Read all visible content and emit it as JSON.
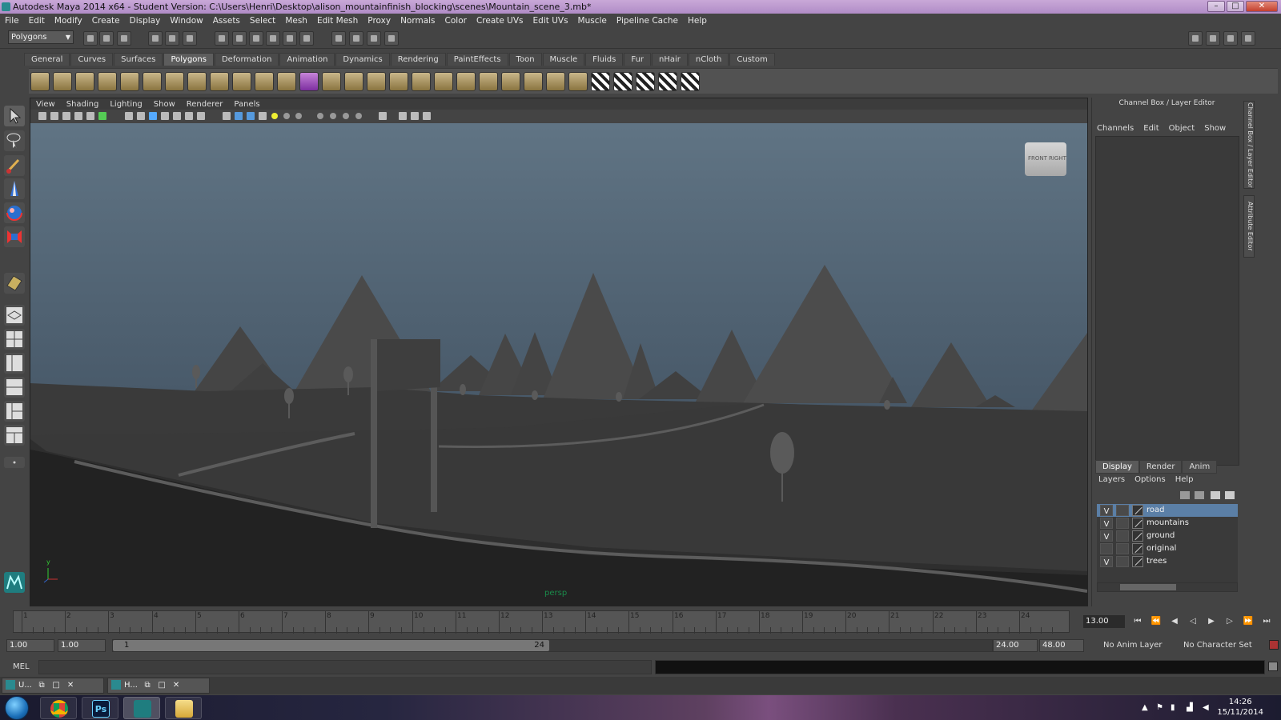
{
  "window": {
    "title": "Autodesk Maya 2014 x64 - Student Version: C:\\Users\\Henri\\Desktop\\alison_mountainfinish_blocking\\scenes\\Mountain_scene_3.mb*",
    "min": "–",
    "max": "□",
    "close": "✕"
  },
  "menubar": [
    "File",
    "Edit",
    "Modify",
    "Create",
    "Display",
    "Window",
    "Assets",
    "Select",
    "Mesh",
    "Edit Mesh",
    "Proxy",
    "Normals",
    "Color",
    "Create UVs",
    "Edit UVs",
    "Muscle",
    "Pipeline Cache",
    "Help"
  ],
  "statusline": {
    "mode": "Polygons"
  },
  "shelf": {
    "tabs": [
      "General",
      "Curves",
      "Surfaces",
      "Polygons",
      "Deformation",
      "Animation",
      "Dynamics",
      "Rendering",
      "PaintEffects",
      "Toon",
      "Muscle",
      "Fluids",
      "Fur",
      "nHair",
      "nCloth",
      "Custom"
    ],
    "active_tab": "Polygons"
  },
  "viewport": {
    "menu": [
      "View",
      "Shading",
      "Lighting",
      "Show",
      "Renderer",
      "Panels"
    ],
    "camera": "persp",
    "viewcube_front": "FRONT",
    "viewcube_right": "RIGHT",
    "axis_y": "y",
    "axis_x": "x"
  },
  "channelbox": {
    "title": "Channel Box / Layer Editor",
    "menu": [
      "Channels",
      "Edit",
      "Object",
      "Show"
    ],
    "layer_tabs": [
      "Display",
      "Render",
      "Anim"
    ],
    "layer_menu": [
      "Layers",
      "Options",
      "Help"
    ],
    "layers": [
      {
        "v": "V",
        "name": "road",
        "selected": true
      },
      {
        "v": "V",
        "name": "mountains",
        "selected": false
      },
      {
        "v": "V",
        "name": "ground",
        "selected": false
      },
      {
        "v": "",
        "name": "original",
        "selected": false
      },
      {
        "v": "V",
        "name": "trees",
        "selected": false
      }
    ],
    "side_tab_1": "Channel Box / Layer Editor",
    "side_tab_2": "Attribute Editor"
  },
  "timeslider": {
    "frames": [
      "1",
      "2",
      "3",
      "4",
      "5",
      "6",
      "7",
      "8",
      "9",
      "10",
      "11",
      "12",
      "13",
      "14",
      "15",
      "16",
      "17",
      "18",
      "19",
      "20",
      "21",
      "22",
      "23",
      "24"
    ],
    "current_frame": "13.00"
  },
  "range": {
    "start": "1.00",
    "playback_start": "1.00",
    "handle_start": "1",
    "handle_end": "24",
    "playback_end": "24.00",
    "end": "48.00",
    "anim_layer": "No Anim Layer",
    "char_set": "No Character Set"
  },
  "cmdline": {
    "label": "MEL"
  },
  "minimized": [
    {
      "label": "U..."
    },
    {
      "label": "H..."
    }
  ],
  "taskbar": {
    "time": "14:26",
    "date": "15/11/2014",
    "ps_label": "Ps"
  },
  "colors": {
    "sky_top": "#5f7180",
    "sky_bottom": "#3a4a58",
    "layer_selected": "#5b7fa6"
  }
}
